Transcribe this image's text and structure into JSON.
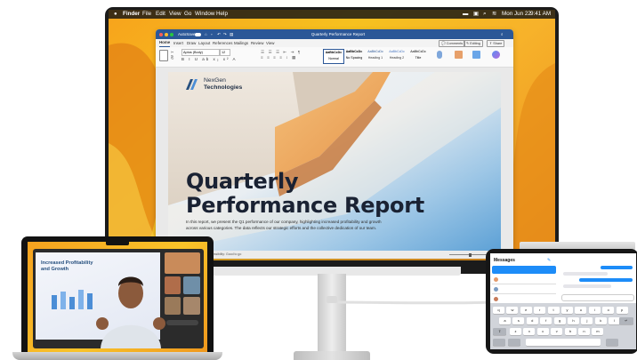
{
  "menubar": {
    "items": [
      "Finder",
      "File",
      "Edit",
      "View",
      "Go",
      "Window",
      "Help"
    ],
    "date": "Mon Jun 22",
    "time": "9:41 AM"
  },
  "word": {
    "title": "Quarterly Performance Report",
    "autosave_label": "AutoSave",
    "tabs": [
      "Home",
      "Insert",
      "Draw",
      "Layout",
      "References",
      "Mailings",
      "Review",
      "View"
    ],
    "comments_label": "Comments",
    "editing_label": "Editing",
    "share_label": "Share",
    "font_name": "Aptos (Body)",
    "font_size": "12",
    "styles": [
      "Normal",
      "No Spacing",
      "Heading 1",
      "Heading 2",
      "Title"
    ],
    "style_sample": "AaBbCcDc",
    "status_text": "Accessibility: Good to go"
  },
  "document": {
    "brand_line1": "NexGen",
    "brand_line2": "Technologies",
    "title_line1": "Quarterly",
    "title_line2": "Performance Report",
    "body_line1": "In this report, we present the Q1 performance of our company, highlighting increased profitability and growth",
    "body_line2": "across various categories. The data reflects our strategic efforts and the collective dedication of our team."
  },
  "laptop": {
    "slide_title_line1": "Increased Profitability",
    "slide_title_line2": "and Growth"
  },
  "ipad": {
    "app_title": "Messages",
    "keyboard_rows": [
      [
        "q",
        "w",
        "e",
        "r",
        "t",
        "y",
        "u",
        "i",
        "o",
        "p"
      ],
      [
        "a",
        "s",
        "d",
        "f",
        "g",
        "h",
        "j",
        "k",
        "l"
      ],
      [
        "z",
        "x",
        "c",
        "v",
        "b",
        "n",
        "m"
      ]
    ]
  },
  "colors": {
    "word_blue": "#2b5797",
    "wallpaper_orange": "#f7a31c",
    "imessage_blue": "#1d8cf8"
  }
}
